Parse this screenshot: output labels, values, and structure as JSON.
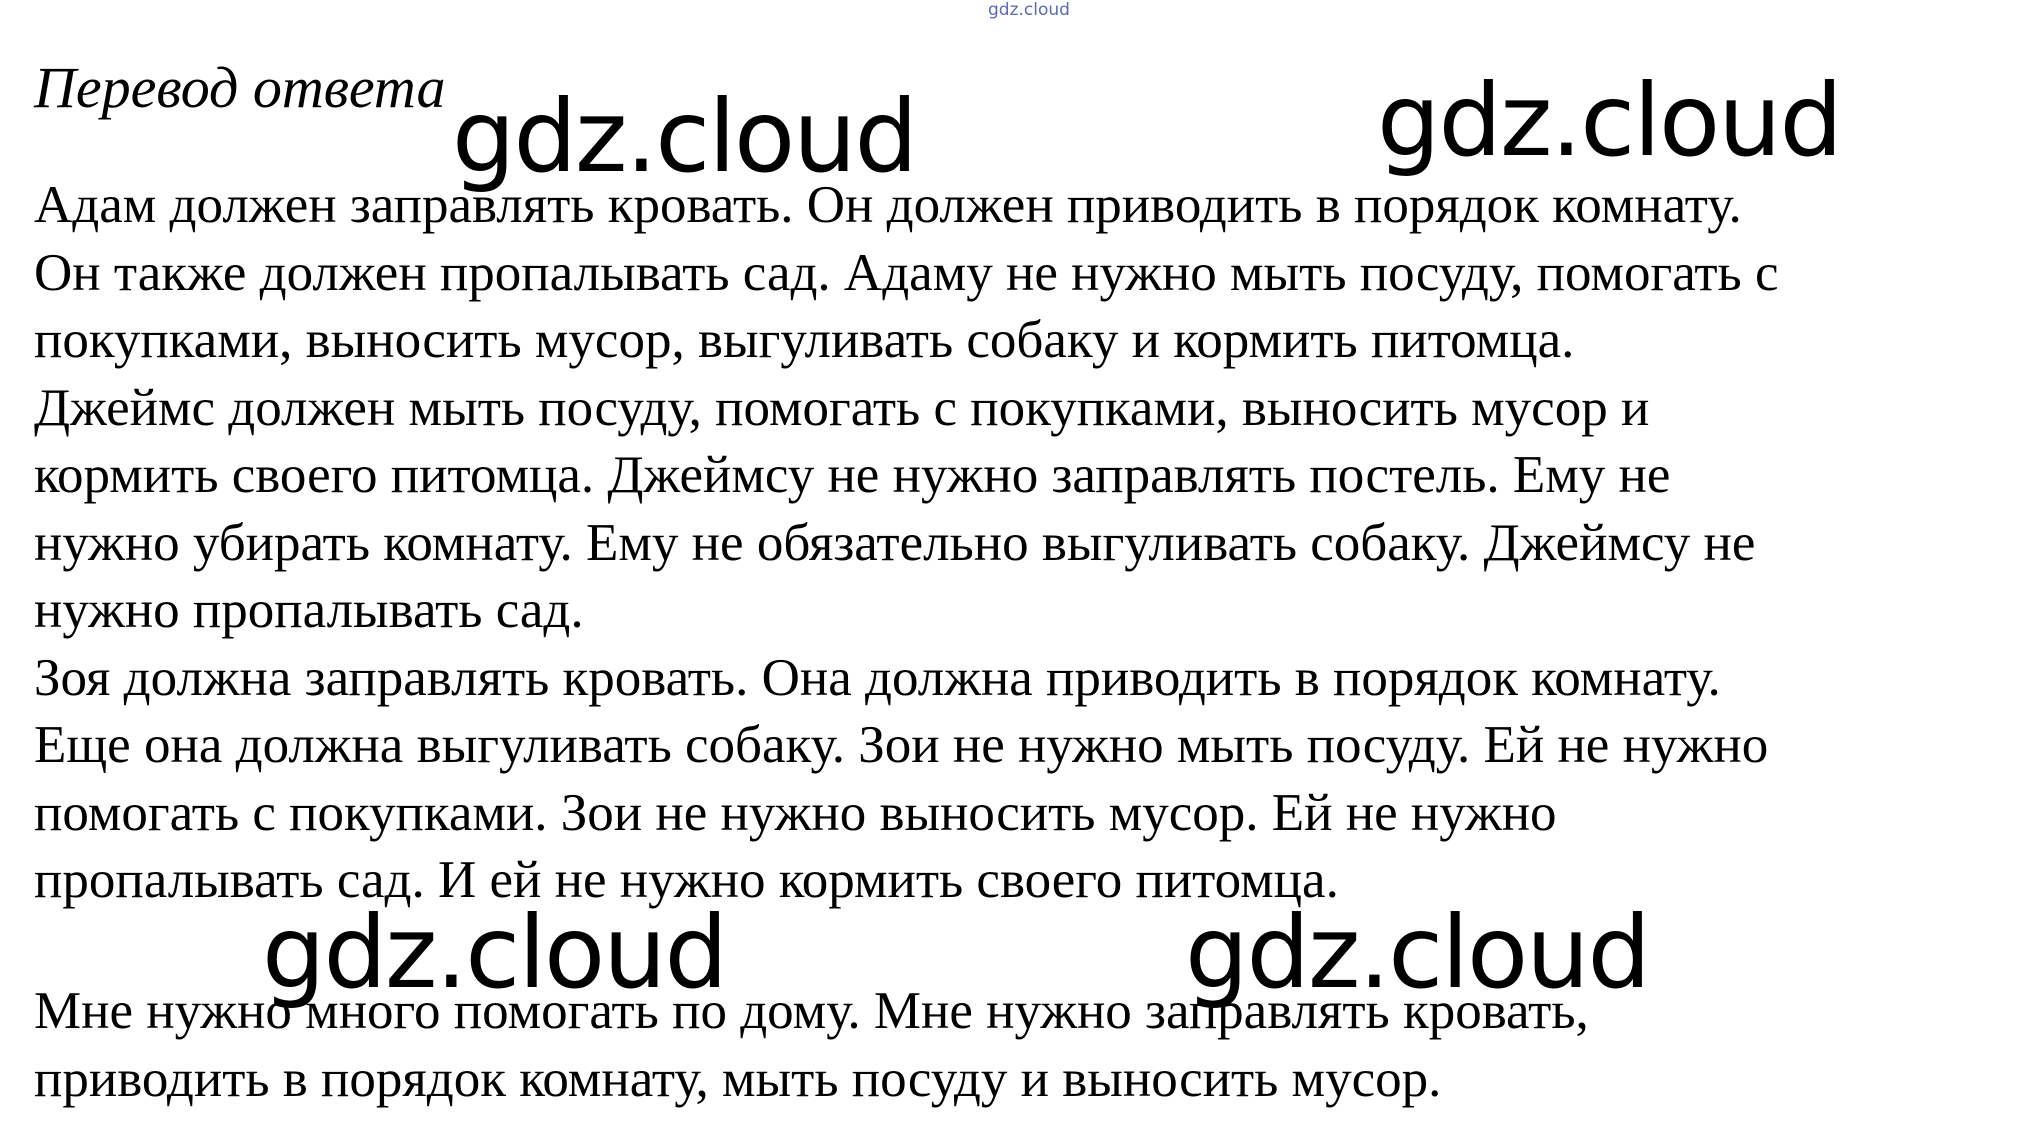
{
  "site_mark": "gdz.cloud",
  "heading": "Перевод ответа",
  "watermarks": [
    "gdz.cloud",
    "gdz.cloud",
    "gdz.cloud",
    "gdz.cloud"
  ],
  "paragraph_1_lines": [
    "Адам должен заправлять кровать. Он должен приводить в порядок комнату.",
    "Он также должен пропалывать сад. Адаму не нужно мыть посуду, помогать с",
    "покупками, выносить мусор, выгуливать собаку и кормить питомца.",
    "Джеймс должен мыть посуду, помогать с покупками, выносить мусор и",
    "кормить своего питомца. Джеймсу не нужно заправлять постель. Ему не",
    "нужно убирать комнату. Ему не обязательно выгуливать собаку. Джеймсу не",
    "нужно пропалывать сад.",
    "Зоя должна заправлять кровать. Она должна приводить в порядок комнату.",
    "Еще она должна выгуливать собаку. Зои не нужно мыть посуду. Ей не нужно",
    "помогать с покупками. Зои не нужно выносить мусор. Ей не нужно",
    "пропалывать сад. И ей не нужно кормить своего питомца."
  ],
  "paragraph_2_lines": [
    "Мне нужно много помогать по дому. Мне нужно заправлять кровать,",
    "приводить в порядок комнату, мыть посуду и выносить мусор."
  ]
}
